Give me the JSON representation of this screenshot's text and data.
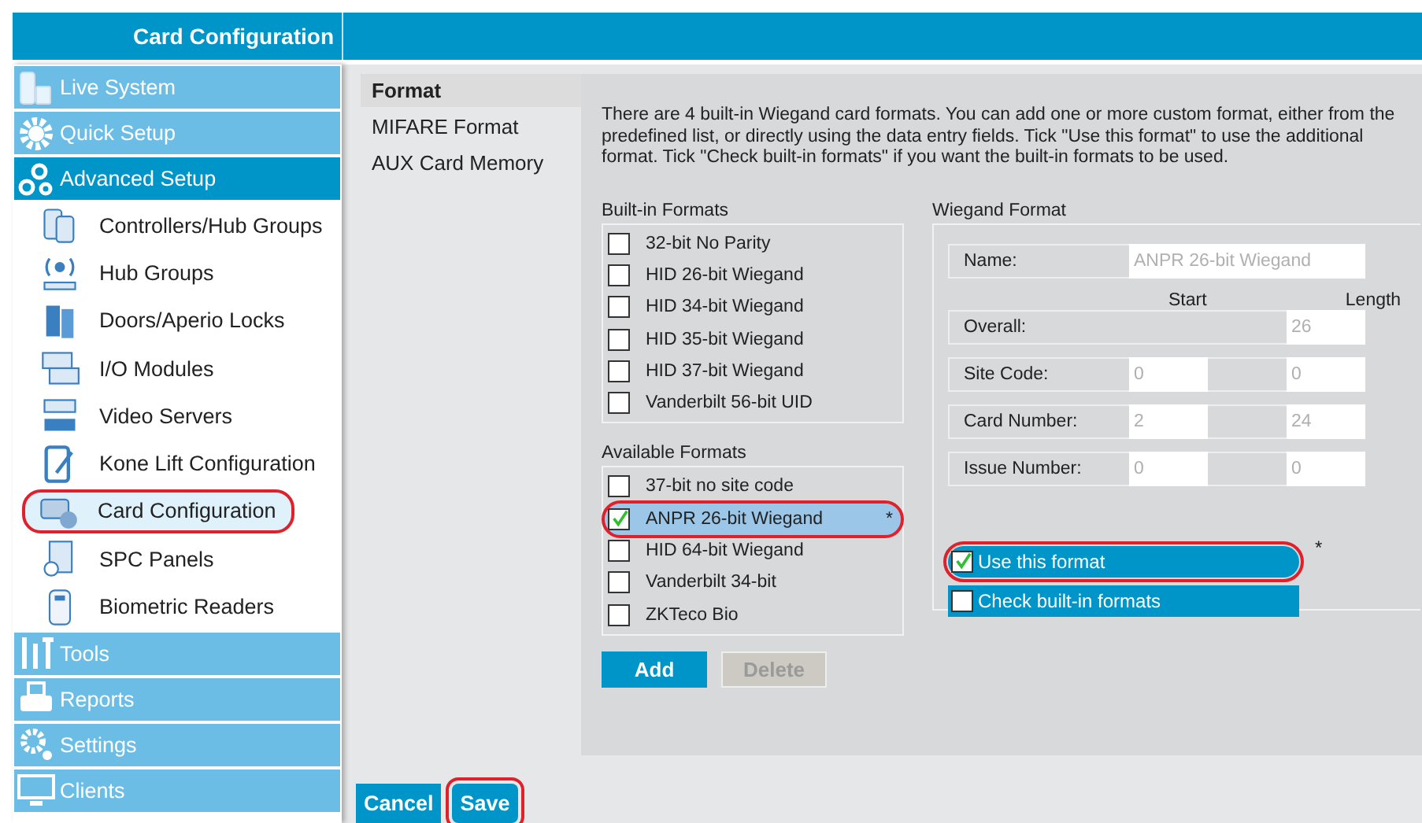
{
  "header": {
    "title": "Card Configuration"
  },
  "sidebar": {
    "items": [
      {
        "label": "Live System",
        "kind": "group",
        "expanded": false,
        "selected": false,
        "circled": false
      },
      {
        "label": "Quick Setup",
        "kind": "group",
        "expanded": false,
        "selected": false,
        "circled": false
      },
      {
        "label": "Advanced Setup",
        "kind": "group",
        "expanded": true,
        "selected": false,
        "circled": false
      },
      {
        "label": "Controllers/Hub Groups",
        "kind": "item",
        "selected": false,
        "circled": false
      },
      {
        "label": "Hub Groups",
        "kind": "item",
        "selected": false,
        "circled": false
      },
      {
        "label": "Doors/Aperio Locks",
        "kind": "item",
        "selected": false,
        "circled": false
      },
      {
        "label": "I/O Modules",
        "kind": "item",
        "selected": false,
        "circled": false
      },
      {
        "label": "Video Servers",
        "kind": "item",
        "selected": false,
        "circled": false
      },
      {
        "label": "Kone Lift Configuration",
        "kind": "item",
        "selected": false,
        "circled": false
      },
      {
        "label": "Card Configuration",
        "kind": "item",
        "selected": true,
        "circled": true
      },
      {
        "label": "SPC Panels",
        "kind": "item",
        "selected": false,
        "circled": false
      },
      {
        "label": "Biometric Readers",
        "kind": "item",
        "selected": false,
        "circled": false
      },
      {
        "label": "Tools",
        "kind": "group",
        "expanded": false,
        "selected": false,
        "circled": false
      },
      {
        "label": "Reports",
        "kind": "group",
        "expanded": false,
        "selected": false,
        "circled": false
      },
      {
        "label": "Settings",
        "kind": "group",
        "expanded": false,
        "selected": false,
        "circled": false
      },
      {
        "label": "Clients",
        "kind": "group",
        "expanded": false,
        "selected": false,
        "circled": false
      }
    ]
  },
  "subnav": {
    "items": [
      {
        "label": "Format",
        "selected": true
      },
      {
        "label": "MIFARE Format",
        "selected": false
      },
      {
        "label": "AUX Card Memory",
        "selected": false
      }
    ]
  },
  "intro": "There are 4 built-in Wiegand card formats. You can add one or more custom format, either from the predefined list, or directly using the data entry fields. Tick \"Use this format\" to use the additional format. Tick \"Check built-in formats\" if you want the built-in formats to be used.",
  "builtin_formats": {
    "title": "Built-in Formats",
    "items": [
      {
        "label": "32-bit No Parity",
        "checked": false
      },
      {
        "label": "HID 26-bit Wiegand",
        "checked": false
      },
      {
        "label": "HID 34-bit Wiegand",
        "checked": false
      },
      {
        "label": "HID 35-bit Wiegand",
        "checked": false
      },
      {
        "label": "HID 37-bit Wiegand",
        "checked": false
      },
      {
        "label": "Vanderbilt 56-bit UID",
        "checked": false
      }
    ]
  },
  "available_formats": {
    "title": "Available Formats",
    "items": [
      {
        "label": "37-bit no site code",
        "checked": false,
        "selected": false,
        "circled": false
      },
      {
        "label": "ANPR 26-bit Wiegand",
        "checked": true,
        "selected": true,
        "circled": true,
        "marker": "*"
      },
      {
        "label": "HID 64-bit Wiegand",
        "checked": false,
        "selected": false,
        "circled": false
      },
      {
        "label": "Vanderbilt 34-bit",
        "checked": false,
        "selected": false,
        "circled": false
      },
      {
        "label": "ZKTeco Bio",
        "checked": false,
        "selected": false,
        "circled": false
      }
    ]
  },
  "format_buttons": [
    {
      "label": "Add",
      "disabled": false
    },
    {
      "label": "Delete",
      "disabled": true
    }
  ],
  "wiegand_format": {
    "title": "Wiegand Format",
    "name": {
      "label": "Name:",
      "value": "ANPR 26-bit Wiegand"
    },
    "columns": [
      "Start",
      "Length"
    ],
    "rows": [
      {
        "label": "Overall:",
        "length": "26"
      },
      {
        "label": "Site Code:",
        "start": "0",
        "length": "0"
      },
      {
        "label": "Card Number:",
        "start": "2",
        "length": "24"
      },
      {
        "label": "Issue Number:",
        "start": "0",
        "length": "0"
      }
    ],
    "options": [
      {
        "label": "Use this format",
        "checked": true,
        "circled": true
      },
      {
        "label": "Check built-in formats",
        "checked": false,
        "circled": false
      }
    ],
    "note": "*"
  },
  "footer_buttons": [
    {
      "label": "Cancel",
      "circled": false
    },
    {
      "label": "Save",
      "circled": true
    }
  ]
}
